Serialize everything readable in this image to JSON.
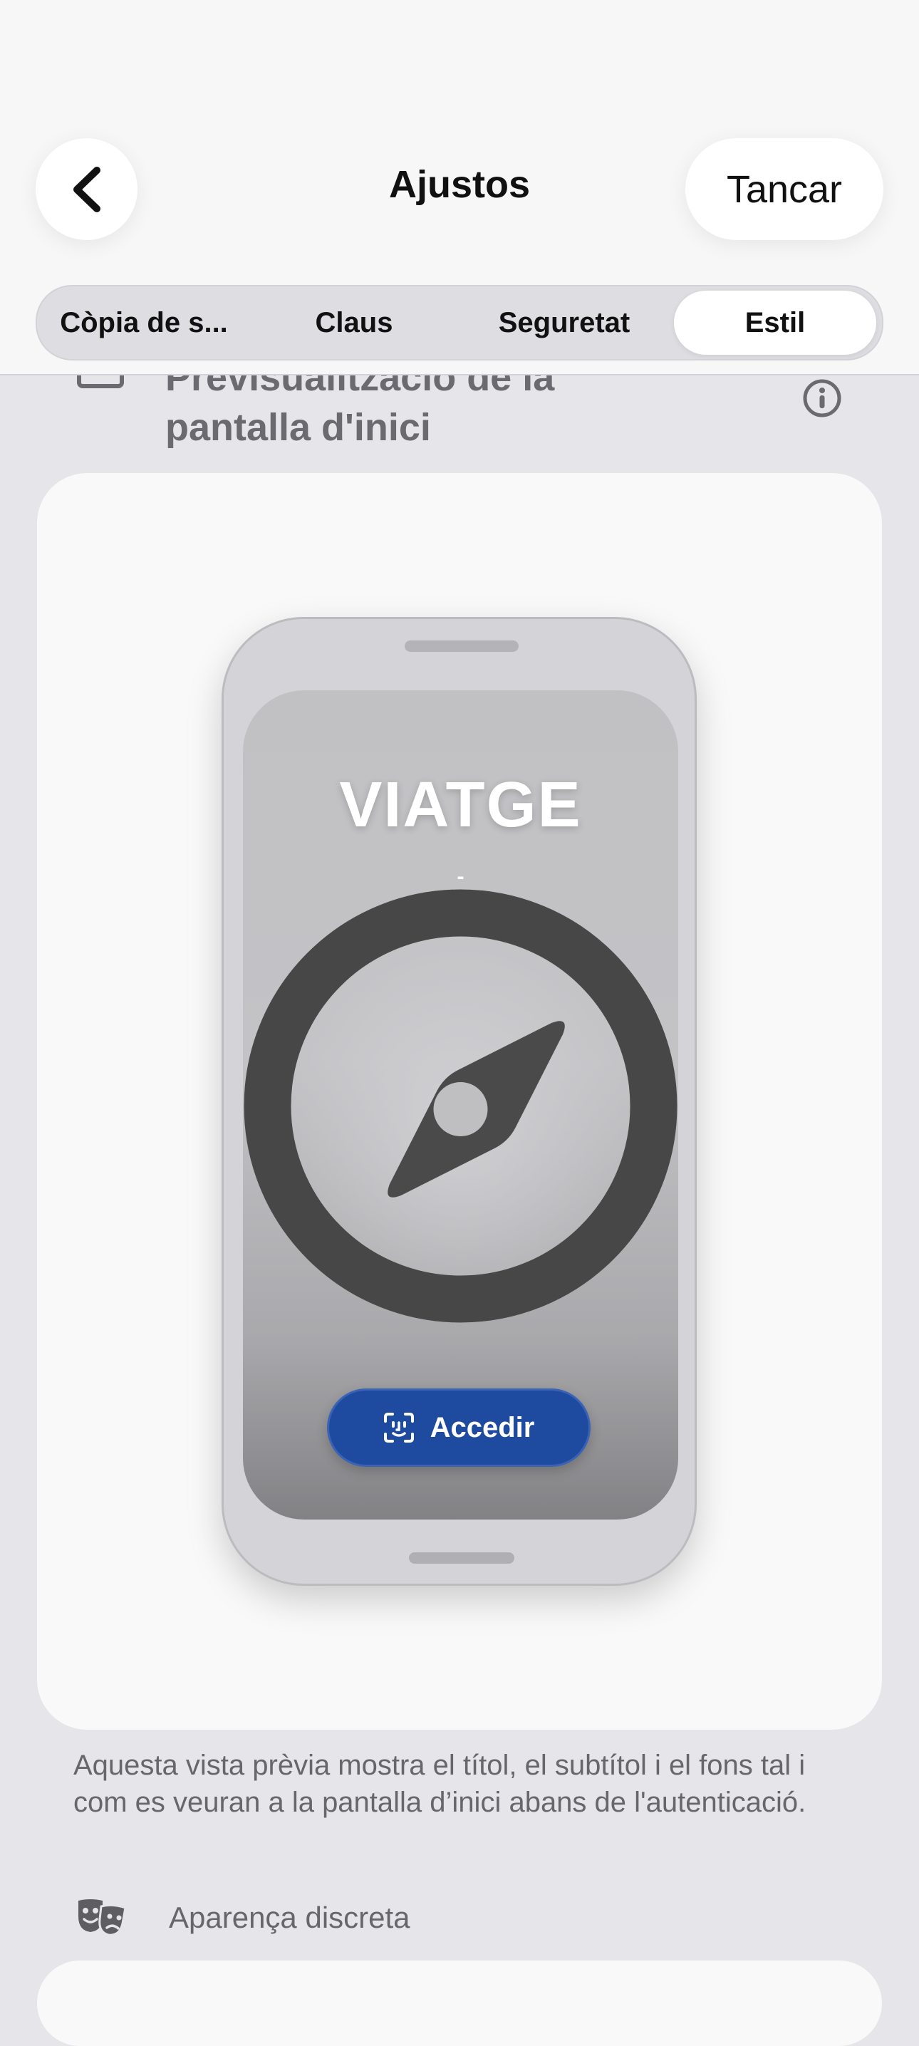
{
  "header": {
    "title": "Ajustos",
    "close_label": "Tancar"
  },
  "tabs": [
    {
      "label": "Còpia de s..."
    },
    {
      "label": "Claus"
    },
    {
      "label": "Seguretat"
    },
    {
      "label": "Estil",
      "selected": true
    }
  ],
  "section": {
    "title": "Previsualització de la pantalla d'inici"
  },
  "preview": {
    "title": "VIATGE",
    "subtitle": "-",
    "button_label": "Accedir",
    "button_color": "#1e4aa0",
    "icon": "compass-icon"
  },
  "description": "Aquesta vista prèvia mostra el títol, el subtítol i el fons tal i com es veuran a la pantalla d’inici abans de l'autenticació.",
  "discreet": {
    "label": "Aparença discreta",
    "icon": "theater-masks-icon"
  }
}
